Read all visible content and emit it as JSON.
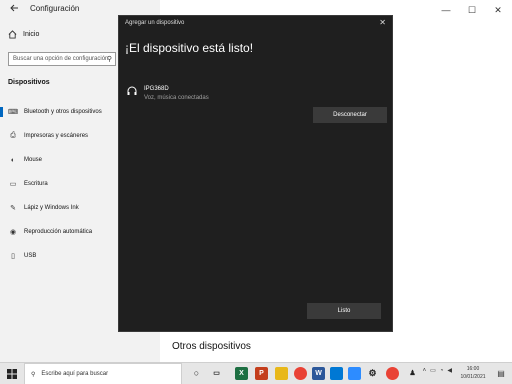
{
  "settings": {
    "app_title": "Configuración",
    "home_label": "Inicio",
    "search_placeholder": "Buscar una opción de configuración",
    "section_label": "Dispositivos",
    "sidebar_items": [
      {
        "label": "Bluetooth y otros dispositivos",
        "icon": "bluetooth-icon"
      },
      {
        "label": "Impresoras y escáneres",
        "icon": "printer-icon"
      },
      {
        "label": "Mouse",
        "icon": "mouse-icon"
      },
      {
        "label": "Escritura",
        "icon": "keyboard-icon"
      },
      {
        "label": "Lápiz y Windows Ink",
        "icon": "pen-icon"
      },
      {
        "label": "Reproducción automática",
        "icon": "autoplay-icon"
      },
      {
        "label": "USB",
        "icon": "usb-icon"
      }
    ],
    "other_devices_heading": "Otros dispositivos"
  },
  "dialog": {
    "title": "Agregar un dispositivo",
    "heading": "¡El dispositivo está listo!",
    "device_name": "IPG368D",
    "device_status": "Voz, música conectadas",
    "disconnect_label": "Desconectar",
    "done_label": "Listo"
  },
  "taskbar": {
    "search_placeholder": "Escribe aquí para buscar",
    "time": "16:00",
    "date": "10/01/2021"
  },
  "colors": {
    "accent": "#0067c0",
    "dialog_bg": "#1f1f1f",
    "button_bg": "#3a3a3a"
  }
}
